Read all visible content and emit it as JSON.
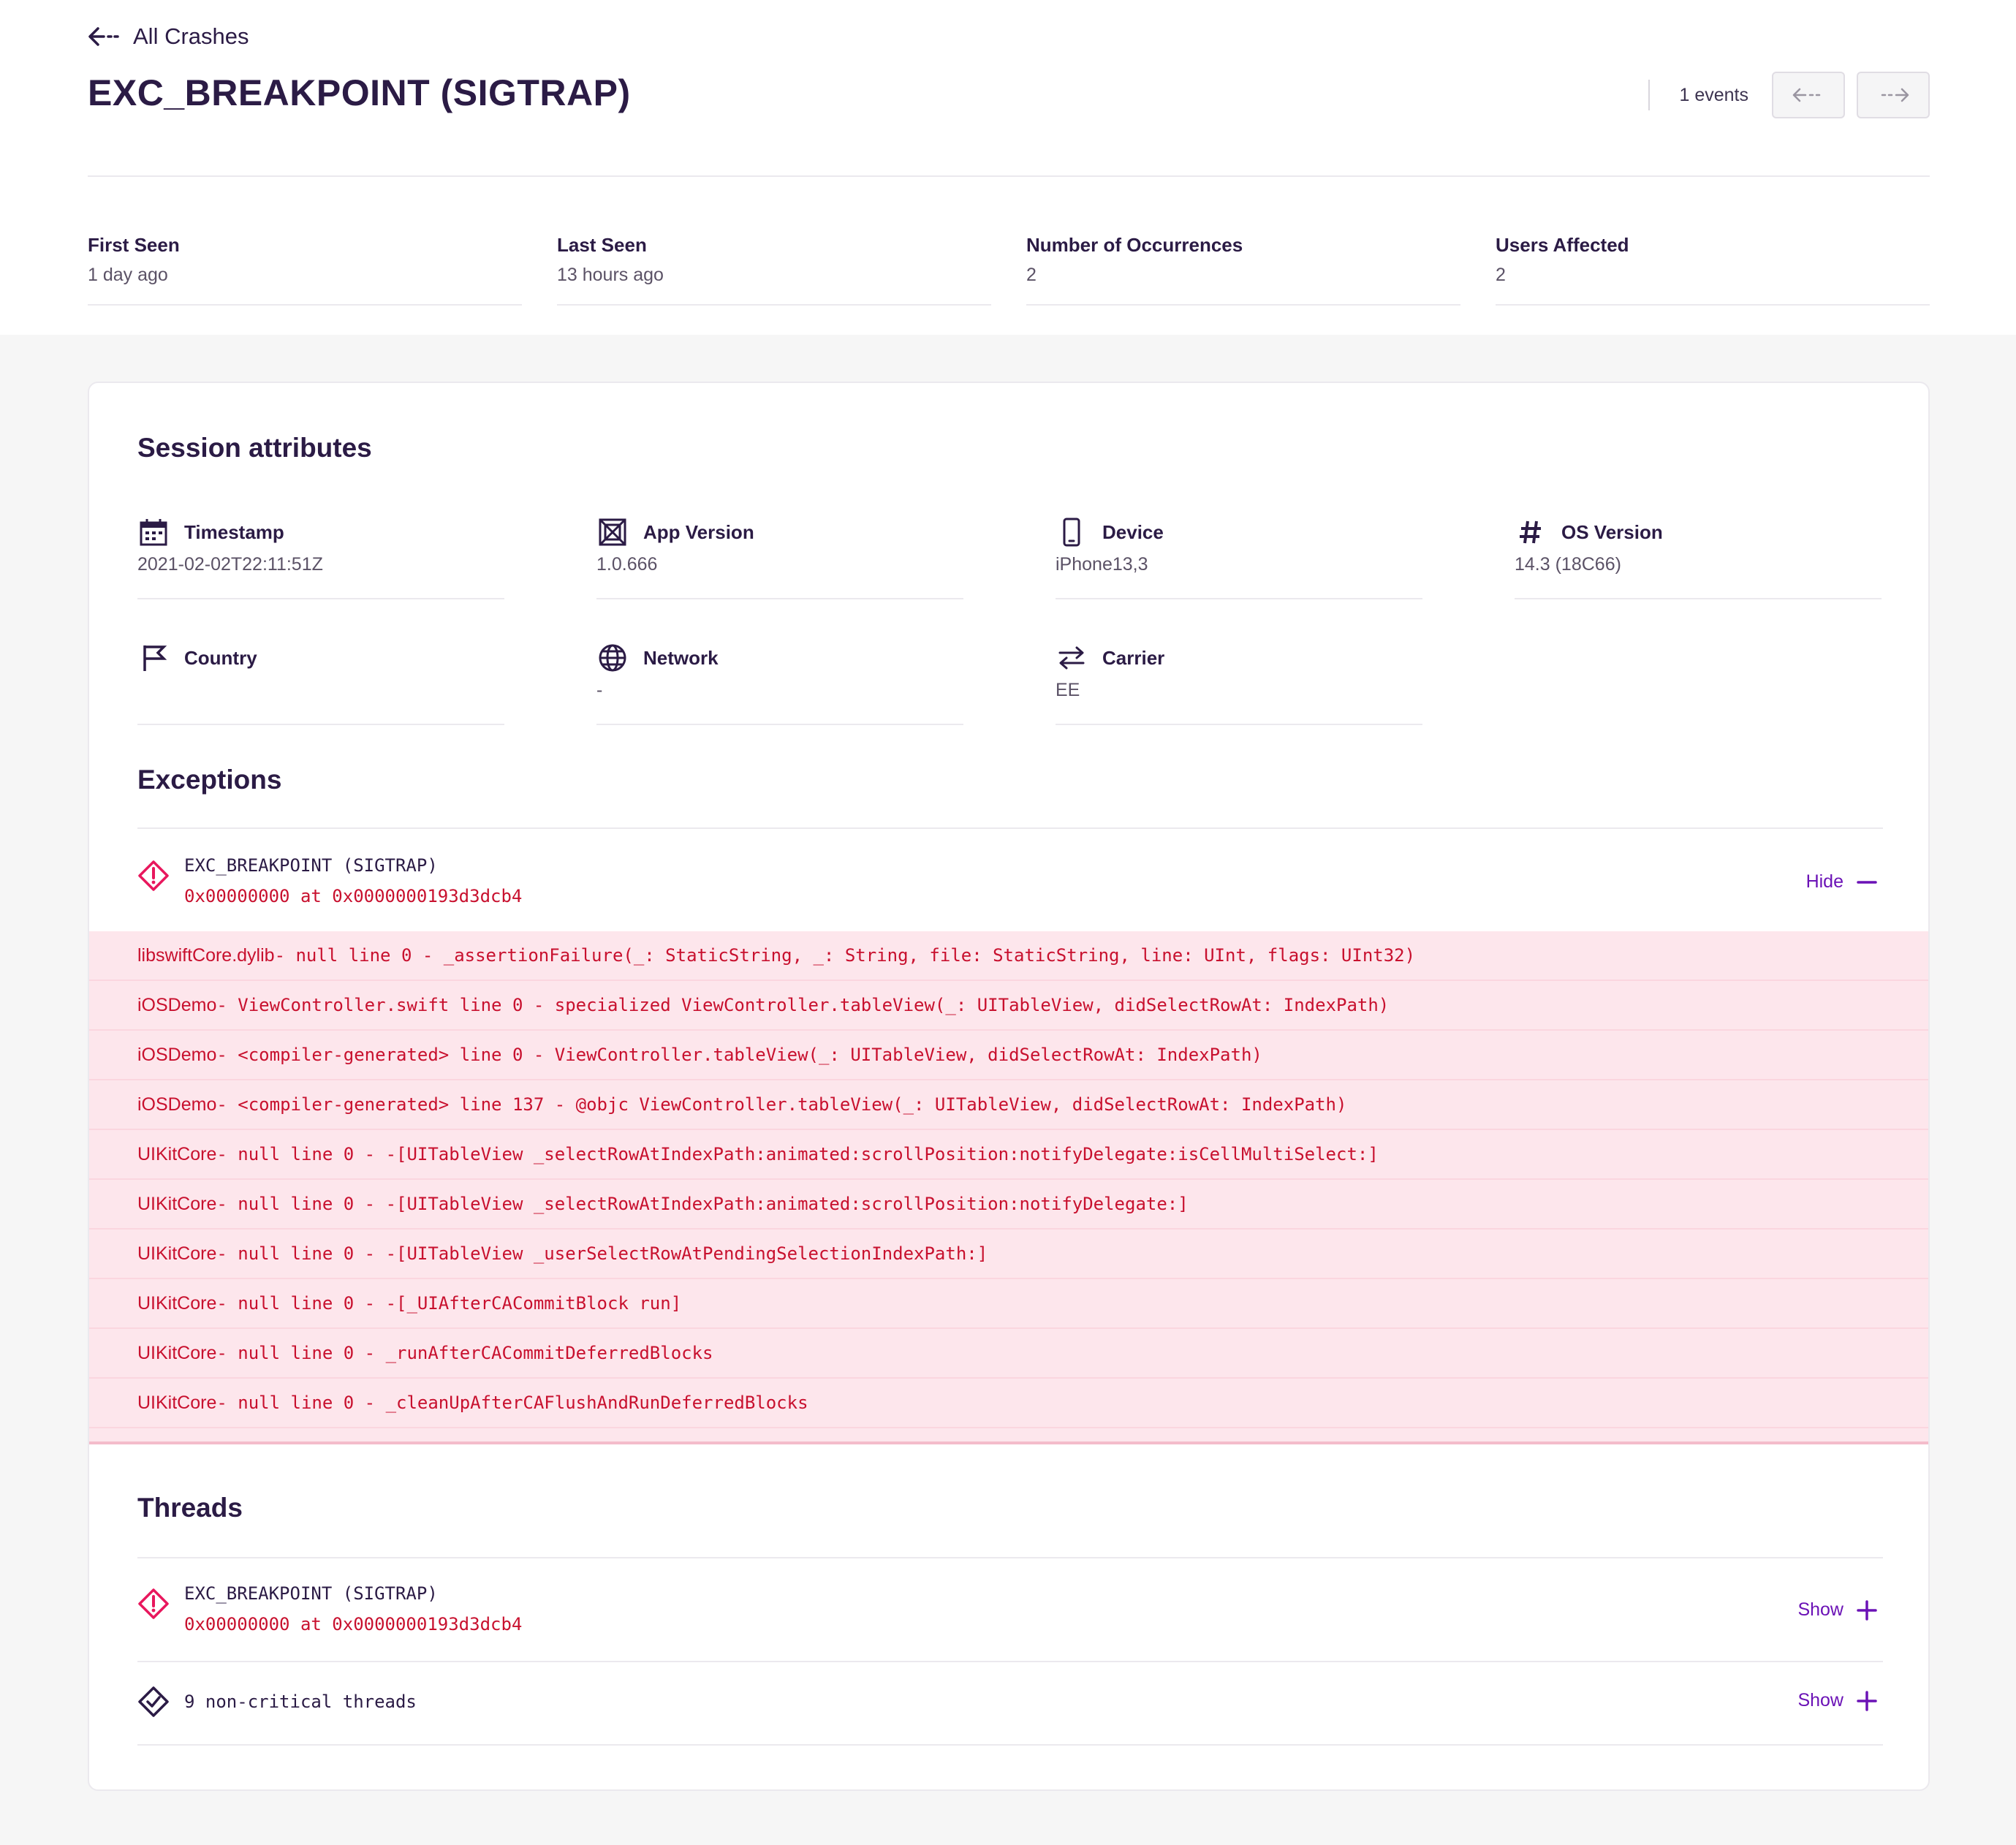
{
  "header": {
    "back_label": "All Crashes",
    "title": "EXC_BREAKPOINT (SIGTRAP)",
    "events_label": "1 events"
  },
  "stats": [
    {
      "label": "First Seen",
      "value": "1 day ago"
    },
    {
      "label": "Last Seen",
      "value": "13 hours ago"
    },
    {
      "label": "Number of Occurrences",
      "value": "2"
    },
    {
      "label": "Users Affected",
      "value": "2"
    }
  ],
  "session": {
    "title": "Session attributes",
    "attributes": [
      {
        "label": "Timestamp",
        "value": "2021-02-02T22:11:51Z",
        "icon": "calendar-icon"
      },
      {
        "label": "App Version",
        "value": "1.0.666",
        "icon": "package-icon"
      },
      {
        "label": "Device",
        "value": "iPhone13,3",
        "icon": "phone-icon"
      },
      {
        "label": "OS Version",
        "value": "14.3 (18C66)",
        "icon": "hash-icon"
      },
      {
        "label": "Country",
        "value": "",
        "icon": "flag-icon"
      },
      {
        "label": "Network",
        "value": "-",
        "icon": "globe-icon"
      },
      {
        "label": "Carrier",
        "value": "EE",
        "icon": "swap-arrows-icon"
      }
    ]
  },
  "exceptions": {
    "title": "Exceptions",
    "item": {
      "name": "EXC_BREAKPOINT (SIGTRAP)",
      "address": "0x00000000 at 0x0000000193d3dcb4",
      "toggle_label": "Hide"
    },
    "frames": [
      {
        "lib": "libswiftCore.dylib",
        "rest": " - null line 0 - _assertionFailure(_: StaticString, _: String, file: StaticString, line: UInt, flags: UInt32)"
      },
      {
        "lib": "iOSDemo",
        "rest": " - ViewController.swift line 0 - specialized ViewController.tableView(_: UITableView, didSelectRowAt: IndexPath)"
      },
      {
        "lib": "iOSDemo",
        "rest": " - <compiler-generated> line 0 - ViewController.tableView(_: UITableView, didSelectRowAt: IndexPath)"
      },
      {
        "lib": "iOSDemo",
        "rest": " - <compiler-generated> line 137 - @objc ViewController.tableView(_: UITableView, didSelectRowAt: IndexPath)"
      },
      {
        "lib": "UIKitCore",
        "rest": " - null line 0 - -[UITableView _selectRowAtIndexPath:animated:scrollPosition:notifyDelegate:isCellMultiSelect:]"
      },
      {
        "lib": "UIKitCore",
        "rest": " - null line 0 - -[UITableView _selectRowAtIndexPath:animated:scrollPosition:notifyDelegate:]"
      },
      {
        "lib": "UIKitCore",
        "rest": " - null line 0 - -[UITableView _userSelectRowAtPendingSelectionIndexPath:]"
      },
      {
        "lib": "UIKitCore",
        "rest": " - null line 0 - -[_UIAfterCACommitBlock run]"
      },
      {
        "lib": "UIKitCore",
        "rest": " - null line 0 - _runAfterCACommitDeferredBlocks"
      },
      {
        "lib": "UIKitCore",
        "rest": " - null line 0 - _cleanUpAfterCAFlushAndRunDeferredBlocks"
      }
    ]
  },
  "threads": {
    "title": "Threads",
    "crashed": {
      "name": "EXC_BREAKPOINT (SIGTRAP)",
      "address": "0x00000000 at 0x0000000193d3dcb4",
      "toggle_label": "Show"
    },
    "noncritical": {
      "label": "9 non-critical threads",
      "toggle_label": "Show"
    }
  },
  "colors": {
    "primary_text": "#2b1b45",
    "accent": "#6b12b6",
    "error": "#c8102e",
    "error_bg": "#fde6ec"
  }
}
